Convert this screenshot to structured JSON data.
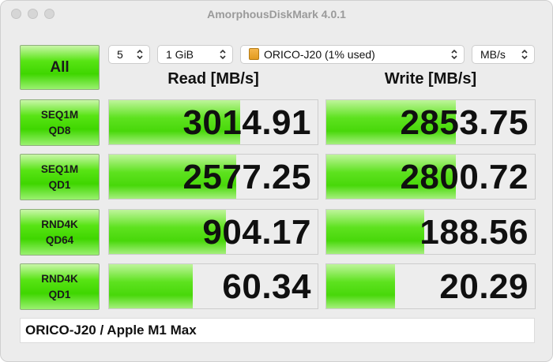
{
  "window": {
    "title": "AmorphousDiskMark 4.0.1"
  },
  "controls": {
    "all_label": "All",
    "count": "5",
    "size": "1 GiB",
    "drive": "ORICO-J20 (1% used)",
    "unit": "MB/s"
  },
  "headers": {
    "read": "Read [MB/s]",
    "write": "Write [MB/s]"
  },
  "tests": [
    {
      "line1": "SEQ1M",
      "line2": "QD8",
      "read": "3014.91",
      "write": "2853.75",
      "read_fill": 0.63,
      "write_fill": 0.62
    },
    {
      "line1": "SEQ1M",
      "line2": "QD1",
      "read": "2577.25",
      "write": "2800.72",
      "read_fill": 0.61,
      "write_fill": 0.62
    },
    {
      "line1": "RND4K",
      "line2": "QD64",
      "read": "904.17",
      "write": "188.56",
      "read_fill": 0.56,
      "write_fill": 0.47
    },
    {
      "line1": "RND4K",
      "line2": "QD1",
      "read": "60.34",
      "write": "20.29",
      "read_fill": 0.4,
      "write_fill": 0.33
    }
  ],
  "comment": "ORICO-J20 / Apple M1 Max"
}
